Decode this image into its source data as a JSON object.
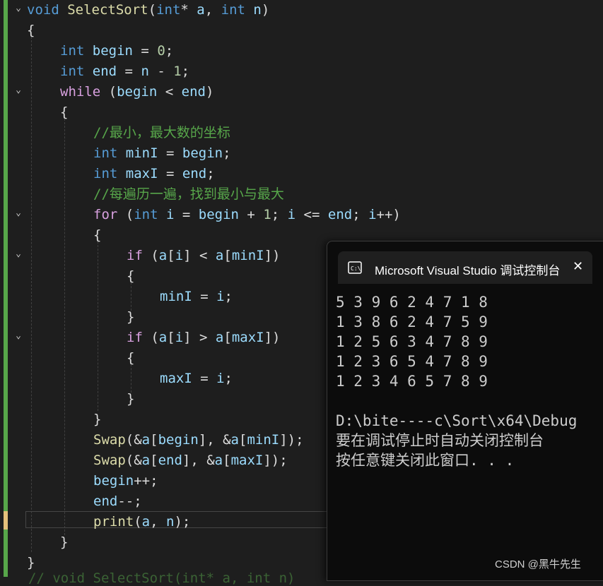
{
  "editor": {
    "lines": [
      {
        "indent": 0,
        "tokens": [
          [
            "kw",
            "void"
          ],
          [
            "plain",
            " "
          ],
          [
            "fn",
            "SelectSort"
          ],
          [
            "plain",
            "("
          ],
          [
            "kw",
            "int"
          ],
          [
            "plain",
            "* "
          ],
          [
            "var",
            "a"
          ],
          [
            "plain",
            ", "
          ],
          [
            "kw",
            "int"
          ],
          [
            "plain",
            " "
          ],
          [
            "var",
            "n"
          ],
          [
            "plain",
            ")"
          ]
        ]
      },
      {
        "indent": 0,
        "tokens": [
          [
            "plain",
            "{"
          ]
        ]
      },
      {
        "indent": 1,
        "tokens": [
          [
            "kw",
            "int"
          ],
          [
            "plain",
            " "
          ],
          [
            "var",
            "begin"
          ],
          [
            "plain",
            " = "
          ],
          [
            "num",
            "0"
          ],
          [
            "plain",
            ";"
          ]
        ]
      },
      {
        "indent": 1,
        "tokens": [
          [
            "kw",
            "int"
          ],
          [
            "plain",
            " "
          ],
          [
            "var",
            "end"
          ],
          [
            "plain",
            " = "
          ],
          [
            "var",
            "n"
          ],
          [
            "plain",
            " - "
          ],
          [
            "num",
            "1"
          ],
          [
            "plain",
            ";"
          ]
        ]
      },
      {
        "indent": 1,
        "tokens": [
          [
            "kw2",
            "while"
          ],
          [
            "plain",
            " ("
          ],
          [
            "var",
            "begin"
          ],
          [
            "plain",
            " < "
          ],
          [
            "var",
            "end"
          ],
          [
            "plain",
            ")"
          ]
        ]
      },
      {
        "indent": 1,
        "tokens": [
          [
            "plain",
            "{"
          ]
        ]
      },
      {
        "indent": 2,
        "tokens": [
          [
            "cm",
            "//最小，最大数的坐标"
          ]
        ]
      },
      {
        "indent": 2,
        "tokens": [
          [
            "kw",
            "int"
          ],
          [
            "plain",
            " "
          ],
          [
            "var",
            "minI"
          ],
          [
            "plain",
            " = "
          ],
          [
            "var",
            "begin"
          ],
          [
            "plain",
            ";"
          ]
        ]
      },
      {
        "indent": 2,
        "tokens": [
          [
            "kw",
            "int"
          ],
          [
            "plain",
            " "
          ],
          [
            "var",
            "maxI"
          ],
          [
            "plain",
            " = "
          ],
          [
            "var",
            "end"
          ],
          [
            "plain",
            ";"
          ]
        ]
      },
      {
        "indent": 2,
        "tokens": [
          [
            "cm",
            "//每遍历一遍，找到最小与最大"
          ]
        ]
      },
      {
        "indent": 2,
        "tokens": [
          [
            "kw2",
            "for"
          ],
          [
            "plain",
            " ("
          ],
          [
            "kw",
            "int"
          ],
          [
            "plain",
            " "
          ],
          [
            "var",
            "i"
          ],
          [
            "plain",
            " = "
          ],
          [
            "var",
            "begin"
          ],
          [
            "plain",
            " + "
          ],
          [
            "num",
            "1"
          ],
          [
            "plain",
            "; "
          ],
          [
            "var",
            "i"
          ],
          [
            "plain",
            " <= "
          ],
          [
            "var",
            "end"
          ],
          [
            "plain",
            "; "
          ],
          [
            "var",
            "i"
          ],
          [
            "plain",
            "++)"
          ]
        ]
      },
      {
        "indent": 2,
        "tokens": [
          [
            "plain",
            "{"
          ]
        ]
      },
      {
        "indent": 3,
        "tokens": [
          [
            "kw2",
            "if"
          ],
          [
            "plain",
            " ("
          ],
          [
            "var",
            "a"
          ],
          [
            "plain",
            "["
          ],
          [
            "var",
            "i"
          ],
          [
            "plain",
            "] < "
          ],
          [
            "var",
            "a"
          ],
          [
            "plain",
            "["
          ],
          [
            "var",
            "minI"
          ],
          [
            "plain",
            "])"
          ]
        ]
      },
      {
        "indent": 3,
        "tokens": [
          [
            "plain",
            "{"
          ]
        ]
      },
      {
        "indent": 4,
        "tokens": [
          [
            "var",
            "minI"
          ],
          [
            "plain",
            " = "
          ],
          [
            "var",
            "i"
          ],
          [
            "plain",
            ";"
          ]
        ]
      },
      {
        "indent": 3,
        "tokens": [
          [
            "plain",
            "}"
          ]
        ]
      },
      {
        "indent": 3,
        "tokens": [
          [
            "kw2",
            "if"
          ],
          [
            "plain",
            " ("
          ],
          [
            "var",
            "a"
          ],
          [
            "plain",
            "["
          ],
          [
            "var",
            "i"
          ],
          [
            "plain",
            "] > "
          ],
          [
            "var",
            "a"
          ],
          [
            "plain",
            "["
          ],
          [
            "var",
            "maxI"
          ],
          [
            "plain",
            "])"
          ]
        ]
      },
      {
        "indent": 3,
        "tokens": [
          [
            "plain",
            "{"
          ]
        ]
      },
      {
        "indent": 4,
        "tokens": [
          [
            "var",
            "maxI"
          ],
          [
            "plain",
            " = "
          ],
          [
            "var",
            "i"
          ],
          [
            "plain",
            ";"
          ]
        ]
      },
      {
        "indent": 3,
        "tokens": [
          [
            "plain",
            "}"
          ]
        ]
      },
      {
        "indent": 2,
        "tokens": [
          [
            "plain",
            "}"
          ]
        ]
      },
      {
        "indent": 2,
        "tokens": [
          [
            "fn",
            "Swap"
          ],
          [
            "plain",
            "(&"
          ],
          [
            "var",
            "a"
          ],
          [
            "plain",
            "["
          ],
          [
            "var",
            "begin"
          ],
          [
            "plain",
            "], &"
          ],
          [
            "var",
            "a"
          ],
          [
            "plain",
            "["
          ],
          [
            "var",
            "minI"
          ],
          [
            "plain",
            "]);"
          ]
        ]
      },
      {
        "indent": 2,
        "tokens": [
          [
            "fn",
            "Swap"
          ],
          [
            "plain",
            "(&"
          ],
          [
            "var",
            "a"
          ],
          [
            "plain",
            "["
          ],
          [
            "var",
            "end"
          ],
          [
            "plain",
            "], &"
          ],
          [
            "var",
            "a"
          ],
          [
            "plain",
            "["
          ],
          [
            "var",
            "maxI"
          ],
          [
            "plain",
            "]);"
          ]
        ]
      },
      {
        "indent": 2,
        "tokens": [
          [
            "var",
            "begin"
          ],
          [
            "plain",
            "++;"
          ]
        ]
      },
      {
        "indent": 2,
        "tokens": [
          [
            "var",
            "end"
          ],
          [
            "plain",
            "--;"
          ]
        ]
      },
      {
        "indent": 2,
        "tokens": [
          [
            "fn",
            "print"
          ],
          [
            "plain",
            "("
          ],
          [
            "var",
            "a"
          ],
          [
            "plain",
            ", "
          ],
          [
            "var",
            "n"
          ],
          [
            "plain",
            ");"
          ]
        ]
      },
      {
        "indent": 1,
        "tokens": [
          [
            "plain",
            "}"
          ]
        ]
      },
      {
        "indent": 0,
        "tokens": [
          [
            "plain",
            "}"
          ]
        ]
      }
    ],
    "fold_markers": [
      "⌄",
      "⌄",
      "⌄",
      "⌄",
      "⌄"
    ],
    "bottom_comment": "// void SelectSort(int* a, int n)"
  },
  "console": {
    "title": "Microsoft Visual Studio 调试控制台",
    "close_icon": "close-icon",
    "output": [
      "5 3 9 6 2 4 7 1 8",
      "1 3 8 6 2 4 7 5 9",
      "1 2 5 6 3 4 7 8 9",
      "1 2 3 6 5 4 7 8 9",
      "1 2 3 4 6 5 7 8 9",
      "",
      "D:\\bite----c\\Sort\\x64\\Debug",
      "要在调试停止时自动关闭控制台",
      "按任意键关闭此窗口. . ."
    ]
  },
  "watermark": "CSDN @黑牛先生",
  "colors": {
    "keyword": "#569cd6",
    "control": "#d8a0df",
    "function": "#dcdcaa",
    "variable": "#9cdcfe",
    "comment": "#57a64a",
    "number": "#b5cea8"
  }
}
